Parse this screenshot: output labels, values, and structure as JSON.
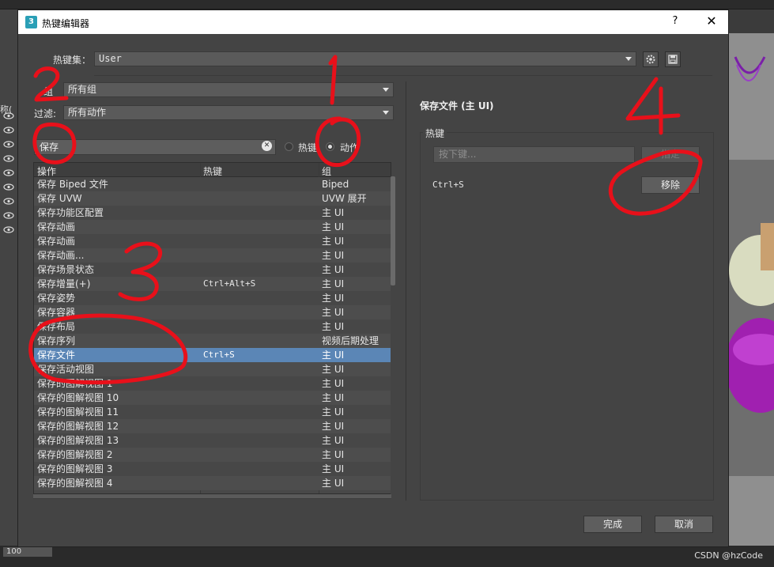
{
  "dialog": {
    "title": "热键编辑器",
    "title_icon": "3",
    "help": "?",
    "close": "✕"
  },
  "hotkey_set": {
    "label": "热键集：",
    "value": "User"
  },
  "group_filter": {
    "label": "组",
    "value": "所有组"
  },
  "filter": {
    "label": "过滤:",
    "value": "所有动作"
  },
  "search": {
    "value": "保存",
    "mode_hotkey_label": "热键",
    "mode_action_label": "动作",
    "selected_mode": "action"
  },
  "table": {
    "headers": [
      "操作",
      "热键",
      "组"
    ],
    "rows": [
      {
        "action": "保存 Biped 文件",
        "hotkey": "",
        "group": "Biped"
      },
      {
        "action": "保存 UVW",
        "hotkey": "",
        "group": "UVW 展开"
      },
      {
        "action": "保存功能区配置",
        "hotkey": "",
        "group": "主 UI"
      },
      {
        "action": "保存动画",
        "hotkey": "",
        "group": "主 UI"
      },
      {
        "action": "保存动画",
        "hotkey": "",
        "group": "主 UI"
      },
      {
        "action": "保存动画...",
        "hotkey": "",
        "group": "主 UI"
      },
      {
        "action": "保存场景状态",
        "hotkey": "",
        "group": "主 UI"
      },
      {
        "action": "保存增量(+)",
        "hotkey": "Ctrl+Alt+S",
        "group": "主 UI"
      },
      {
        "action": "保存姿势",
        "hotkey": "",
        "group": "主 UI"
      },
      {
        "action": "保存容器",
        "hotkey": "",
        "group": "主 UI"
      },
      {
        "action": "保存布局",
        "hotkey": "",
        "group": "主 UI"
      },
      {
        "action": "保存序列",
        "hotkey": "",
        "group": "视频后期处理"
      },
      {
        "action": "保存文件",
        "hotkey": "Ctrl+S",
        "group": "主 UI",
        "selected": true
      },
      {
        "action": "保存活动视图",
        "hotkey": "",
        "group": "主 UI"
      },
      {
        "action": "保存的图解视图 1",
        "hotkey": "",
        "group": "主 UI"
      },
      {
        "action": "保存的图解视图 10",
        "hotkey": "",
        "group": "主 UI"
      },
      {
        "action": "保存的图解视图 11",
        "hotkey": "",
        "group": "主 UI"
      },
      {
        "action": "保存的图解视图 12",
        "hotkey": "",
        "group": "主 UI"
      },
      {
        "action": "保存的图解视图 13",
        "hotkey": "",
        "group": "主 UI"
      },
      {
        "action": "保存的图解视图 2",
        "hotkey": "",
        "group": "主 UI"
      },
      {
        "action": "保存的图解视图 3",
        "hotkey": "",
        "group": "主 UI"
      },
      {
        "action": "保存的图解视图 4",
        "hotkey": "",
        "group": "主 UI"
      }
    ]
  },
  "detail": {
    "title": "保存文件 (主 UI)",
    "hotkey_group_label": "热键",
    "press_key_placeholder": "按下键...",
    "assign_label": "指定",
    "current_hotkey": "Ctrl+S",
    "remove_label": "移除"
  },
  "footer": {
    "ok_label": "完成",
    "cancel_label": "取消"
  },
  "background": {
    "name_label": "称(",
    "bottom_field": "100",
    "watermark": "CSDN @hzCode"
  },
  "annotations": [
    "1",
    "2",
    "3",
    "4"
  ],
  "colors": {
    "selection": "#5b86b6",
    "annotation": "#e8101a",
    "dialog_bg": "#444444"
  }
}
